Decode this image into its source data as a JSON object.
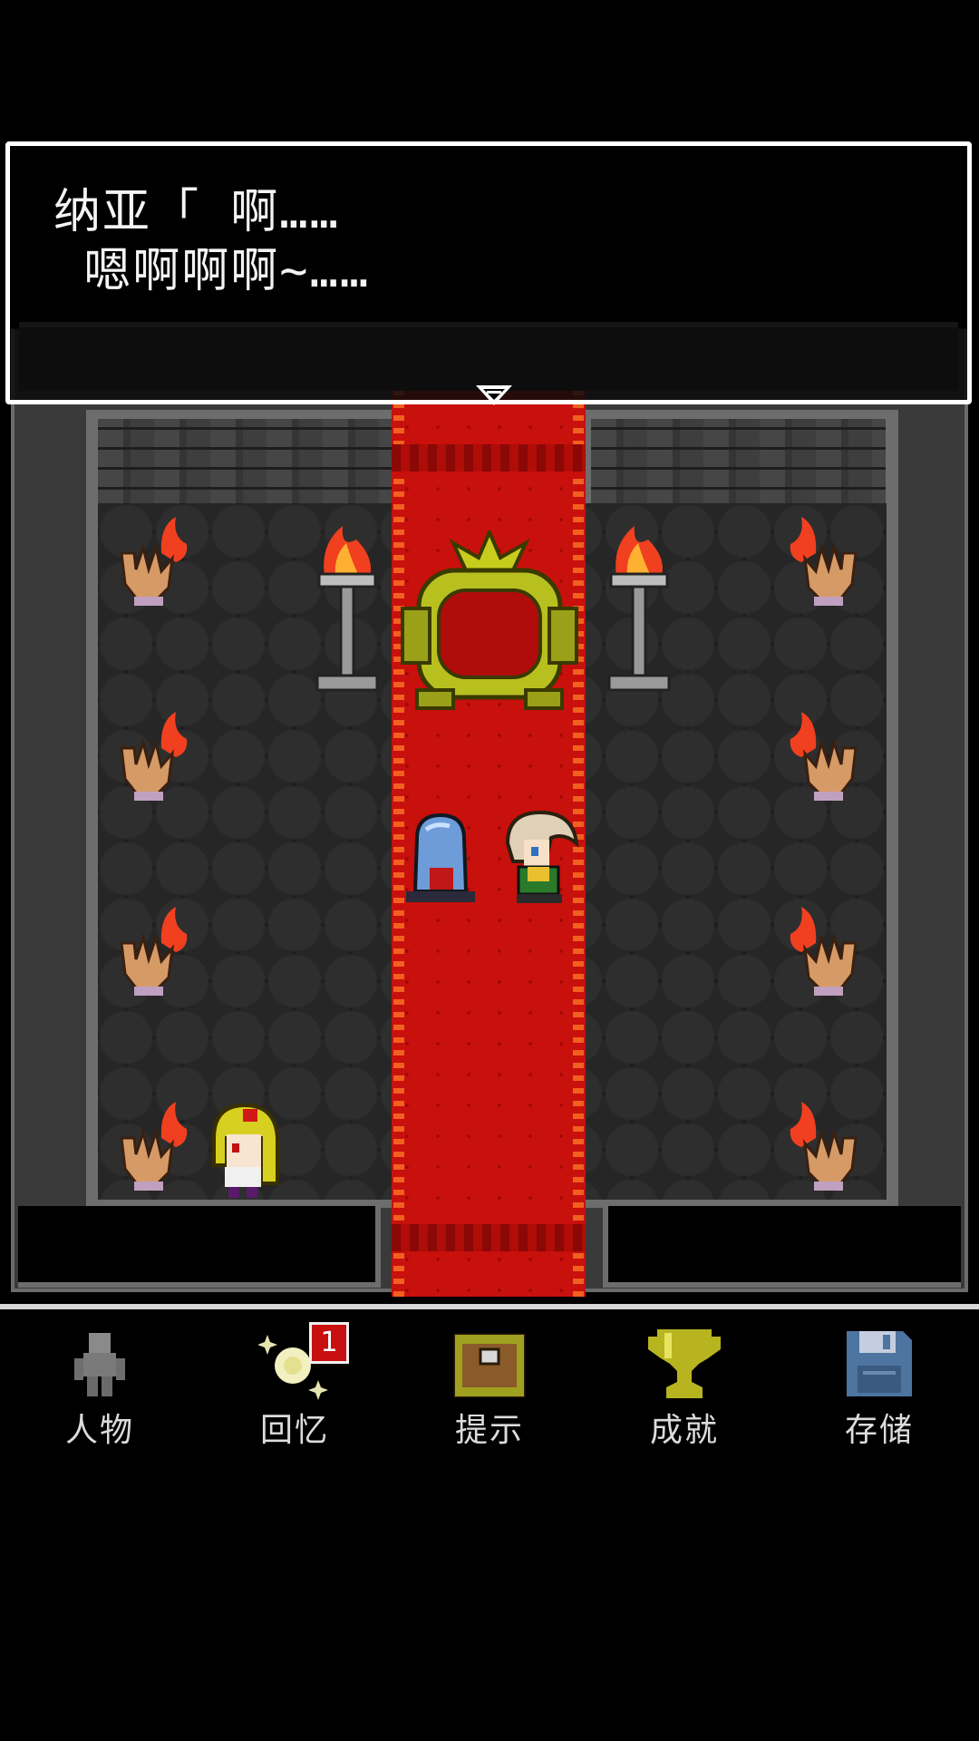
{
  "dialog": {
    "line1": "纳亚「 啊……",
    "line2": " 嗯啊啊啊~……"
  },
  "menu": {
    "items": [
      {
        "label": "人物",
        "icon": "character-silhouette-icon"
      },
      {
        "label": "回忆",
        "icon": "sparkle-memory-icon",
        "badge": "1"
      },
      {
        "label": "提示",
        "icon": "treasure-chest-icon"
      },
      {
        "label": "成就",
        "icon": "trophy-icon"
      },
      {
        "label": "存储",
        "icon": "floppy-disk-icon"
      }
    ]
  },
  "colors": {
    "carpet": "#c8100c",
    "badge": "#c81010",
    "throne": "#b8c020",
    "flame": "#f04020"
  }
}
